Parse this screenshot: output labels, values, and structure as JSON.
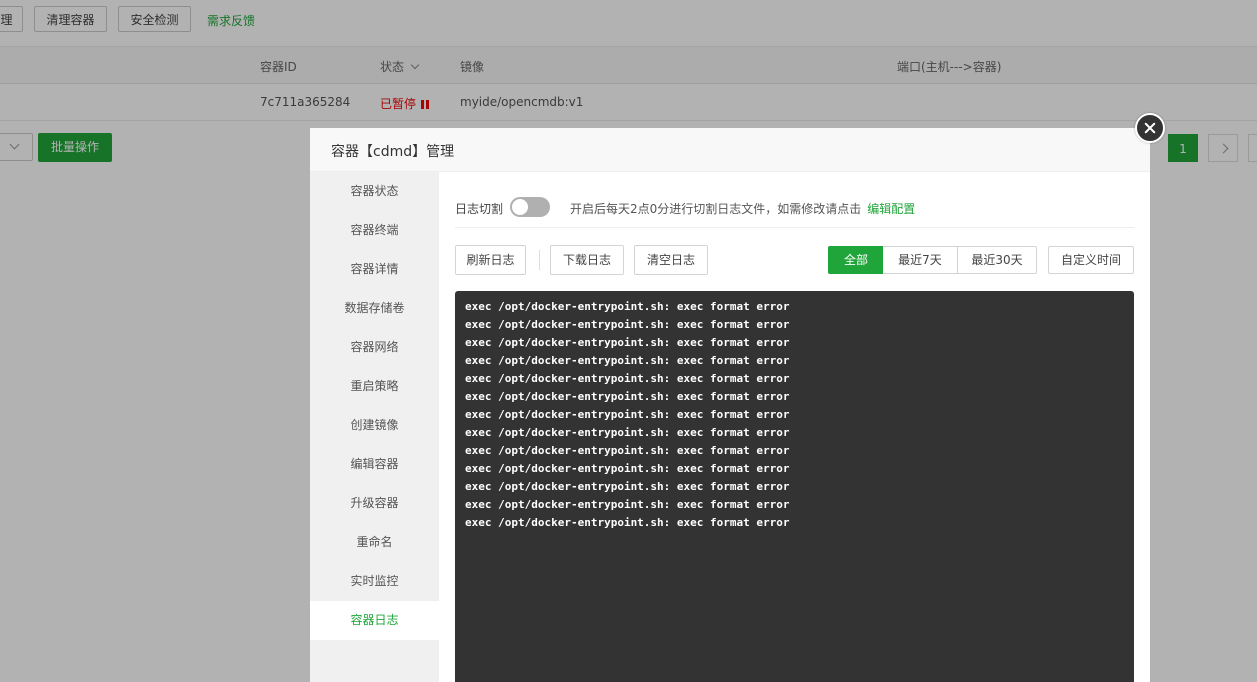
{
  "toolbar": {
    "partial_label": "理",
    "clean_label": "清理容器",
    "security_label": "安全检测",
    "feedback_label": "需求反馈"
  },
  "table": {
    "headers": {
      "id": "容器ID",
      "status": "状态",
      "image": "镜像",
      "ports": "端口(主机--->容器)"
    },
    "row": {
      "id": "7c711a365284",
      "status": "已暂停",
      "image": "myide/opencmdb:v1"
    }
  },
  "footer": {
    "batch_label": "批量操作",
    "page": "1"
  },
  "dialog": {
    "title": "容器【cdmd】管理",
    "menu": [
      "容器状态",
      "容器终端",
      "容器详情",
      "数据存储卷",
      "容器网络",
      "重启策略",
      "创建镜像",
      "编辑容器",
      "升级容器",
      "重命名",
      "实时监控",
      "容器日志"
    ],
    "active_menu": "容器日志",
    "log_cut_label": "日志切割",
    "log_cut_enabled": false,
    "hint_text": "开启后每天2点0分进行切割日志文件，如需修改请点击",
    "hint_link": "编辑配置",
    "buttons": {
      "refresh": "刷新日志",
      "download": "下载日志",
      "clear": "清空日志"
    },
    "ranges": {
      "all": "全部",
      "d7": "最近7天",
      "d30": "最近30天"
    },
    "active_range": "全部",
    "custom_time": "自定义时间",
    "log_lines": [
      "exec /opt/docker-entrypoint.sh: exec format error",
      "exec /opt/docker-entrypoint.sh: exec format error",
      "exec /opt/docker-entrypoint.sh: exec format error",
      "exec /opt/docker-entrypoint.sh: exec format error",
      "exec /opt/docker-entrypoint.sh: exec format error",
      "exec /opt/docker-entrypoint.sh: exec format error",
      "exec /opt/docker-entrypoint.sh: exec format error",
      "exec /opt/docker-entrypoint.sh: exec format error",
      "exec /opt/docker-entrypoint.sh: exec format error",
      "exec /opt/docker-entrypoint.sh: exec format error",
      "exec /opt/docker-entrypoint.sh: exec format error",
      "exec /opt/docker-entrypoint.sh: exec format error",
      "exec /opt/docker-entrypoint.sh: exec format error"
    ]
  },
  "colors": {
    "accent": "#20a53a",
    "paused": "#ef0808",
    "terminal_bg": "#333333"
  }
}
